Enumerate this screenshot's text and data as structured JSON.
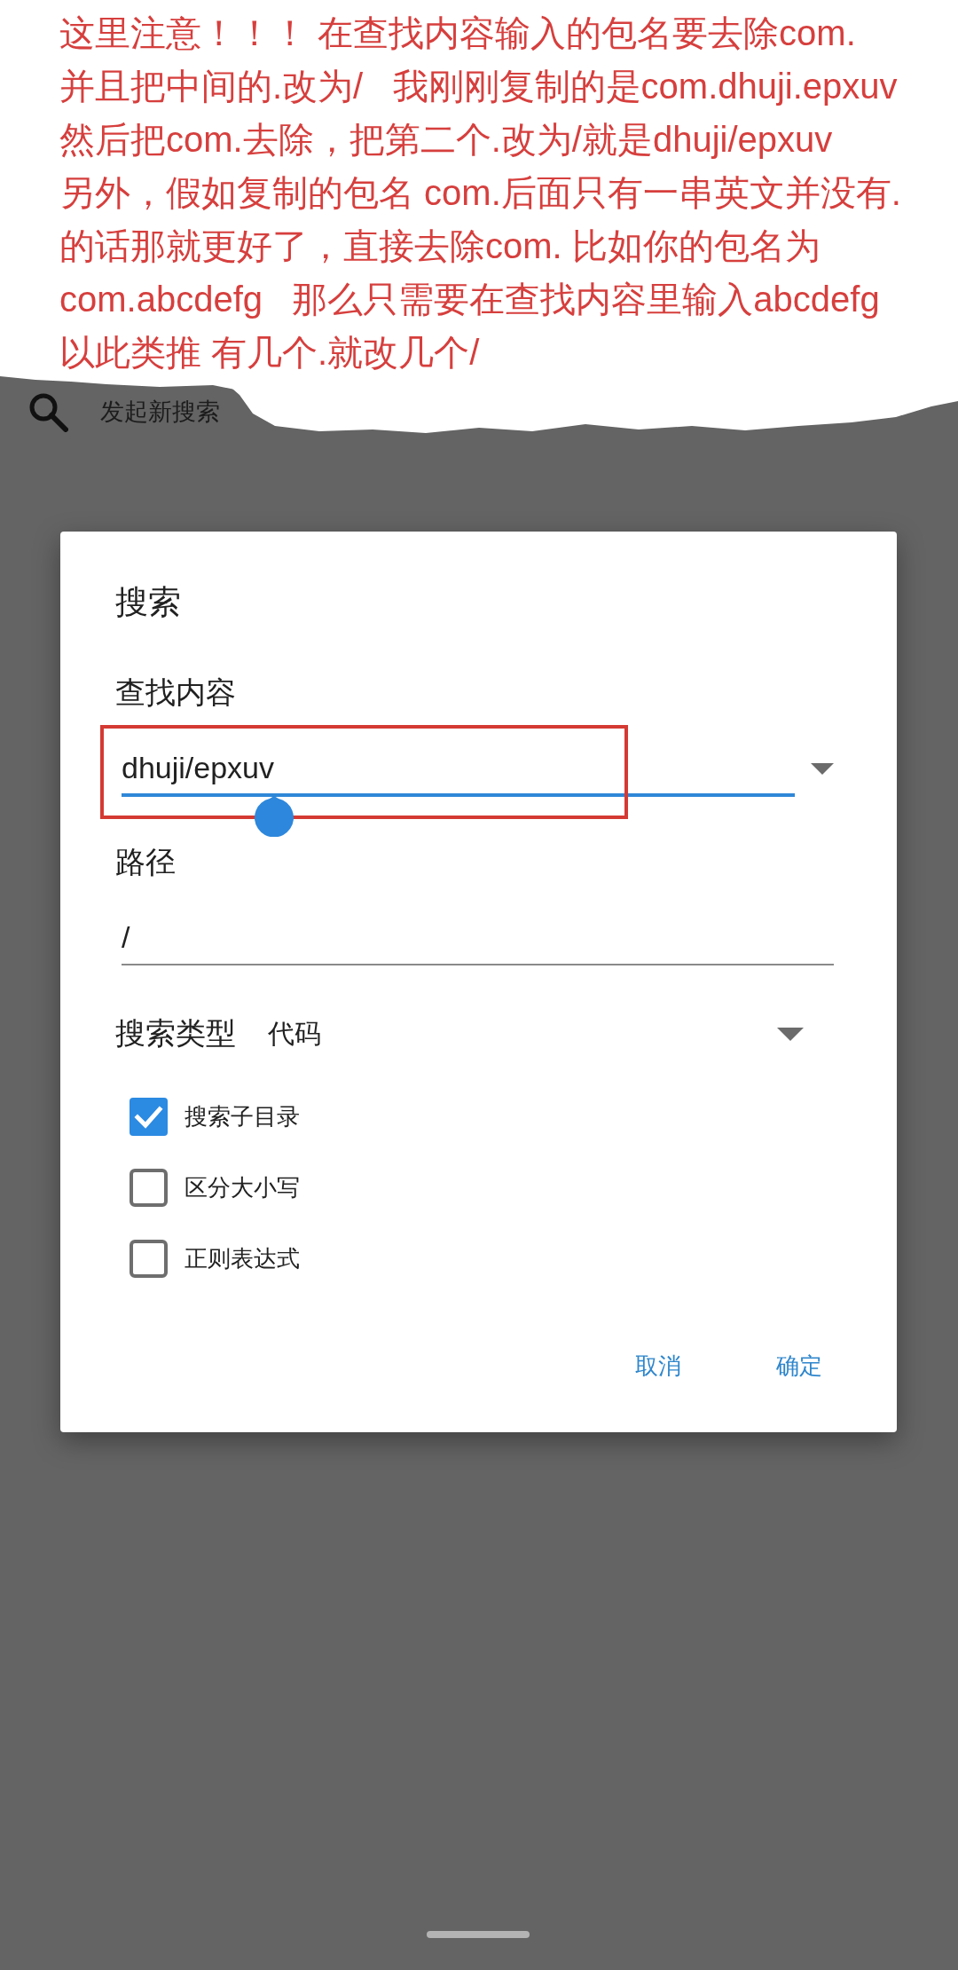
{
  "annotation": {
    "lines": [
      "这里注意！！！ 在查找内容输入的包名要去除com.",
      "并且把中间的.改为/   我刚刚复制的是com.dhuji.epxuv",
      "然后把com.去除，把第二个.改为/就是dhuji/epxuv",
      "另外，假如复制的包名 com.后面只有一串英文并没有.",
      "的话那就更好了，直接去除com. 比如你的包名为",
      "com.abcdefg   那么只需要在查找内容里输入abcdefg",
      "以此类推 有几个.就改几个/"
    ]
  },
  "toolbar": {
    "search_label": "发起新搜索"
  },
  "dialog": {
    "title": "搜索",
    "fields": [
      {
        "kind": "history",
        "label": "查找内容",
        "value": "dhuji/epxuv",
        "focused": true,
        "highlighted": true
      },
      {
        "kind": "text",
        "label": "路径",
        "value": "/",
        "focused": false,
        "highlighted": false
      }
    ],
    "search_type": {
      "label": "搜索类型",
      "value": "代码"
    },
    "options": [
      {
        "label": "搜索子目录",
        "checked": true
      },
      {
        "label": "区分大小写",
        "checked": false
      },
      {
        "label": "正则表达式",
        "checked": false
      }
    ],
    "buttons": [
      "取消",
      "确定"
    ]
  }
}
